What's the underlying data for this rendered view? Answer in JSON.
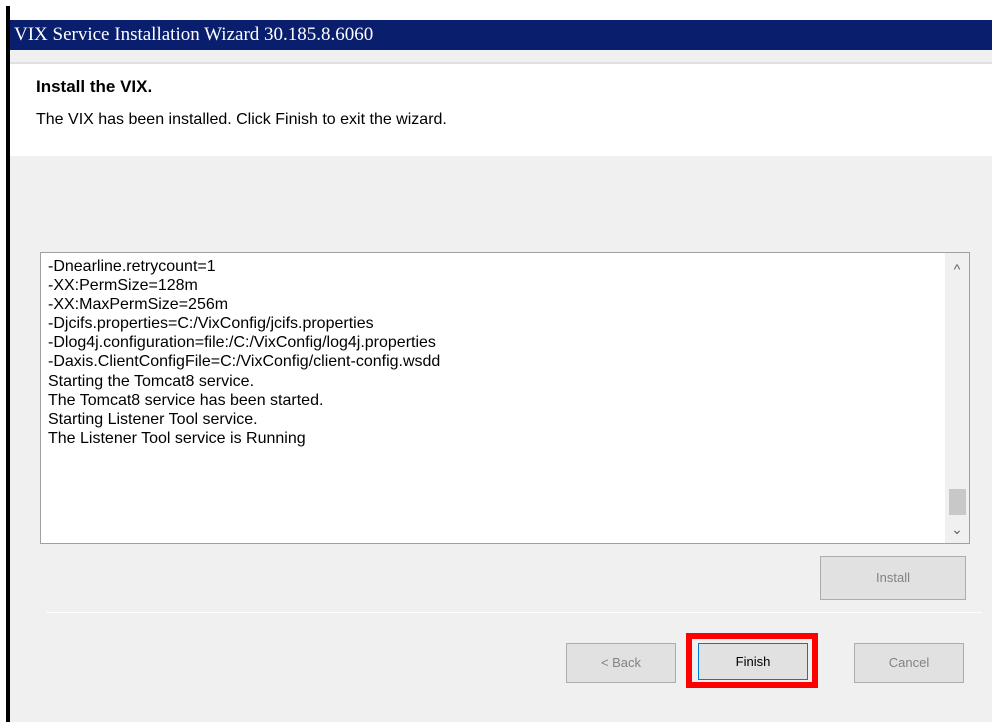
{
  "window": {
    "title": "VIX Service Installation Wizard 30.185.8.6060"
  },
  "header": {
    "title": "Install the VIX.",
    "description": "The VIX has been installed. Click Finish to exit the wizard."
  },
  "log": {
    "lines": [
      "-Dnearline.retrycount=1",
      "-XX:PermSize=128m",
      "-XX:MaxPermSize=256m",
      "-Djcifs.properties=C:/VixConfig/jcifs.properties",
      "-Dlog4j.configuration=file:/C:/VixConfig/log4j.properties",
      "-Daxis.ClientConfigFile=C:/VixConfig/client-config.wsdd",
      "Starting the Tomcat8 service.",
      "The Tomcat8 service has been started.",
      "Starting Listener Tool service.",
      "The Listener Tool service is Running"
    ]
  },
  "icons": {
    "scroll_up": "chevron-up-icon",
    "scroll_down": "chevron-down-icon"
  },
  "glyphs": {
    "scroll_up": "^",
    "scroll_down": "⌄"
  },
  "buttons": {
    "install": "Install",
    "back": "< Back",
    "finish": "Finish",
    "cancel": "Cancel"
  },
  "colors": {
    "titlebar": "#0a1e6e",
    "highlight": "#ff0000"
  }
}
